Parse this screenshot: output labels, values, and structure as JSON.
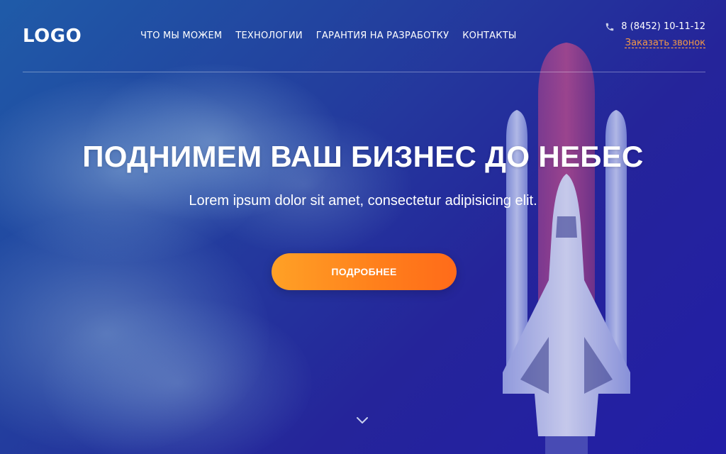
{
  "header": {
    "logo": "LOGO",
    "nav": [
      {
        "label": "ЧТО МЫ МОЖЕМ"
      },
      {
        "label": "ТЕХНОЛОГИИ"
      },
      {
        "label": "ГАРАНТИЯ НА РАЗРАБОТКУ"
      },
      {
        "label": "КОНТАКТЫ"
      }
    ],
    "phone": "8 (8452) 10-11-12",
    "callback_label": "Заказать звонок"
  },
  "hero": {
    "title": "ПОДНИМЕМ ВАШ БИЗНЕС ДО НЕБЕС",
    "subtitle": "Lorem ipsum dolor sit amet, consectetur adipisicing elit.",
    "cta_label": "ПОДРОБНЕЕ"
  },
  "icons": {
    "phone": "phone-icon",
    "scroll": "chevron-down-icon",
    "background": "rocket-image"
  },
  "colors": {
    "accent": "#ff8a1f",
    "callback_link": "#f59a45",
    "background": "#2433a0"
  }
}
